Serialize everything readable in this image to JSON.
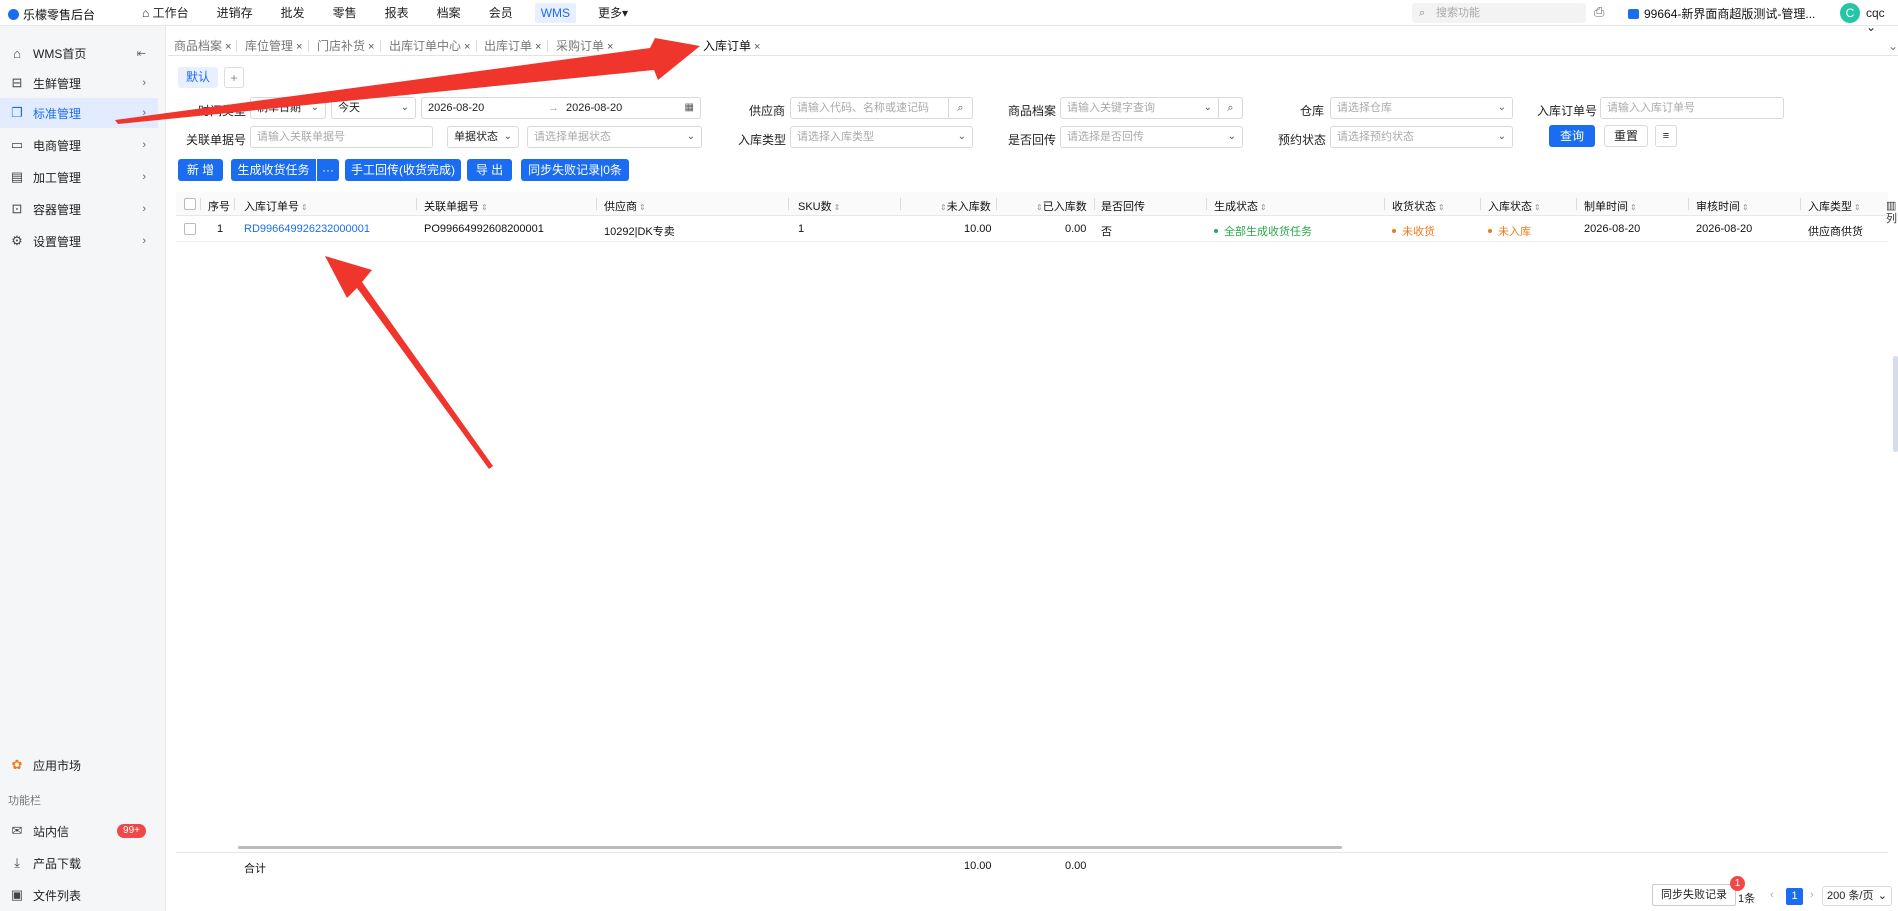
{
  "app": {
    "logo_text": "乐檬零售后台"
  },
  "topnav": {
    "items": [
      "工作台",
      "进销存",
      "批发",
      "零售",
      "报表",
      "档案",
      "会员",
      "WMS",
      "更多"
    ],
    "search_placeholder": "搜索功能",
    "store_name": "99664-新界面商超版测试-管理...",
    "avatar_letter": "C",
    "user_name": "cqc"
  },
  "sidebar": {
    "items": [
      {
        "label": "WMS首页",
        "icon": "home-icon"
      },
      {
        "label": "生鲜管理",
        "icon": "basket-icon"
      },
      {
        "label": "标准管理",
        "icon": "copy-icon"
      },
      {
        "label": "电商管理",
        "icon": "monitor-icon"
      },
      {
        "label": "加工管理",
        "icon": "clipboard-icon"
      },
      {
        "label": "容器管理",
        "icon": "box-icon"
      },
      {
        "label": "设置管理",
        "icon": "gear-icon"
      }
    ],
    "app_market": "应用市场",
    "function_bar_label": "功能栏",
    "messages": "站内信",
    "messages_badge": "99+",
    "product_download": "产品下载",
    "file_list": "文件列表"
  },
  "tabs": [
    "商品档案",
    "库位管理",
    "门店补货",
    "出库订单中心",
    "出库订单",
    "采购订单",
    "入库订单"
  ],
  "view_tabs": {
    "default": "默认",
    "add": "+"
  },
  "filters": {
    "time_type_label": "时间类型",
    "time_type_value": "制单日期",
    "period_value": "今天",
    "date_start": "2026-08-20",
    "date_sep": "→",
    "date_end": "2026-08-20",
    "supplier_label": "供应商",
    "supplier_placeholder": "请输入代码、名称或速记码",
    "goods_label": "商品档案",
    "goods_placeholder": "请输入关键字查询",
    "warehouse_label": "仓库",
    "warehouse_placeholder": "请选择仓库",
    "order_no_label": "入库订单号",
    "order_no_placeholder": "请输入入库订单号",
    "related_label": "关联单据号",
    "related_placeholder": "请输入关联单据号",
    "doc_status_select": "单据状态",
    "doc_status_placeholder": "请选择单据状态",
    "in_type_label": "入库类型",
    "in_type_placeholder": "请选择入库类型",
    "writeback_label": "是否回传",
    "writeback_placeholder": "请选择是否回传",
    "reserve_label": "预约状态",
    "reserve_placeholder": "请选择预约状态",
    "query": "查询",
    "reset": "重置"
  },
  "actions": {
    "add": "新 增",
    "gen_task": "生成收货任务",
    "more": "···",
    "manual_writeback": "手工回传(收货完成)",
    "export": "导 出",
    "sync_fail": "同步失败记录|0条"
  },
  "table": {
    "headers": [
      "序号",
      "入库订单号",
      "关联单据号",
      "供应商",
      "SKU数",
      "未入库数",
      "已入库数",
      "是否回传",
      "生成状态",
      "收货状态",
      "入库状态",
      "制单时间",
      "审核时间",
      "入库类型"
    ],
    "rows": [
      {
        "seq": "1",
        "order_no": "RD996649926232000001",
        "related_no": "PO99664992608200001",
        "supplier": "10292|DK专卖",
        "sku": "1",
        "not_in": "10.00",
        "in_qty": "0.00",
        "writeback": "否",
        "gen_status": "全部生成收货任务",
        "recv_status": "未收货",
        "in_status": "未入库",
        "create_time": "2026-08-20",
        "audit_time": "2026-08-20",
        "in_type": "供应商供货"
      }
    ],
    "summary": {
      "label": "合计",
      "not_in": "10.00",
      "in_qty": "0.00"
    },
    "column_setting": "列"
  },
  "pagination": {
    "sync_fail_btn": "同步失败记录",
    "notif_count": "1",
    "total_suffix": "1条",
    "current": "1",
    "page_size": "200 条/页"
  },
  "colors": {
    "primary": "#1a6cf0",
    "success": "#2aa84a",
    "warning": "#f07a1a",
    "annotation": "#f0352c"
  }
}
